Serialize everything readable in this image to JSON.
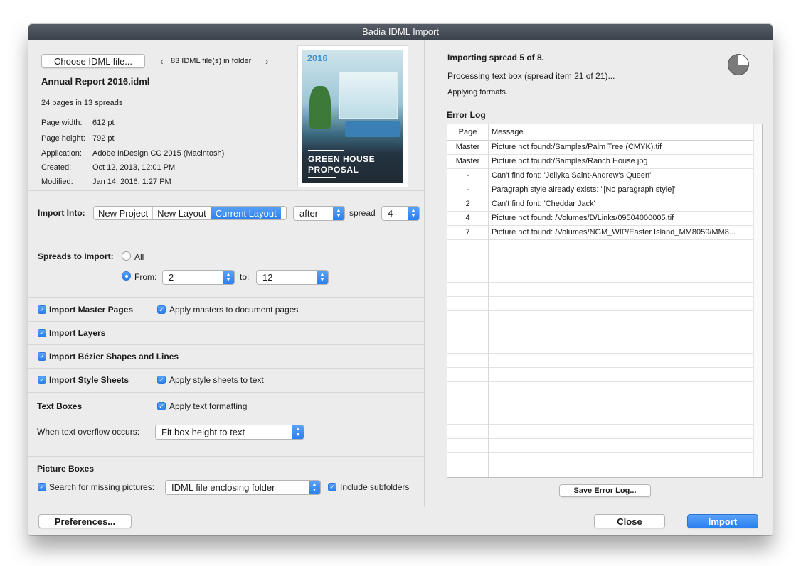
{
  "window": {
    "title": "Badia IDML Import"
  },
  "file": {
    "choose_label": "Choose IDML file...",
    "folder_count": "83 IDML file(s) in folder",
    "name": "Annual Report 2016.idml",
    "summary": "24 pages in 13 spreads",
    "info": [
      {
        "label": "Page width:",
        "value": "612 pt"
      },
      {
        "label": "Page height:",
        "value": "792 pt"
      },
      {
        "label": "Application:",
        "value": "Adobe InDesign CC 2015 (Macintosh)"
      },
      {
        "label": "Created:",
        "value": "Oct 12, 2013, 12:01 PM"
      },
      {
        "label": "Modified:",
        "value": "Jan 14, 2016, 1:27 PM"
      }
    ]
  },
  "thumbnail": {
    "year": "2016",
    "title_line1": "GREEN HOUSE",
    "title_line2": "PROPOSAL"
  },
  "import_into": {
    "label": "Import Into:",
    "options": [
      "New Project",
      "New Layout",
      "Current Layout"
    ],
    "selected": "Current Layout",
    "position_value": "after",
    "spread_label": "spread",
    "spread_value": "4"
  },
  "spreads": {
    "label": "Spreads to Import:",
    "all_label": "All",
    "from_label": "From:",
    "from_value": "2",
    "to_label": "to:",
    "to_value": "12"
  },
  "options": {
    "master_pages": "Import Master Pages",
    "apply_masters": "Apply masters to document pages",
    "layers": "Import Layers",
    "bezier": "Import Bézier Shapes and Lines",
    "style_sheets": "Import Style Sheets",
    "apply_style_sheets": "Apply style sheets to text",
    "text_boxes": "Text Boxes",
    "apply_text_formatting": "Apply text formatting",
    "overflow_label": "When text overflow occurs:",
    "overflow_value": "Fit box height to text",
    "picture_boxes": "Picture Boxes",
    "search_missing": "Search for missing pictures:",
    "search_value": "IDML file enclosing folder",
    "include_subfolders": "Include subfolders"
  },
  "progress": {
    "status": "Importing spread 5 of 8.",
    "detail": "Processing text box (spread item 21 of 21)...",
    "step": "Applying formats...",
    "fraction": 0.75
  },
  "error_log": {
    "title": "Error Log",
    "col_page": "Page",
    "col_message": "Message",
    "rows": [
      {
        "page": "Master",
        "message": "Picture not found:/Samples/Palm Tree (CMYK).tif"
      },
      {
        "page": "Master",
        "message": "Picture not found:/Samples/Ranch House.jpg"
      },
      {
        "page": "-",
        "message": "Can't find font: 'Jellyka Saint-Andrew's Queen'"
      },
      {
        "page": "-",
        "message": "Paragraph style already exists: \"[No paragraph style]\""
      },
      {
        "page": "2",
        "message": "Can't find font: 'Cheddar Jack'"
      },
      {
        "page": "4",
        "message": "Picture not found: /Volumes/D/Links/09504000005.tif"
      },
      {
        "page": "7",
        "message": "Picture not found: /Volumes/NGM_WIP/Easter Island_MM8059/MM8..."
      }
    ],
    "save_label": "Save Error Log..."
  },
  "footer": {
    "preferences_label": "Preferences...",
    "close_label": "Close",
    "import_label": "Import"
  }
}
